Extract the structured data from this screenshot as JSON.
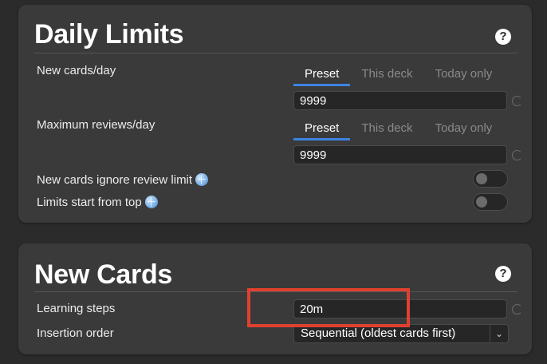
{
  "daily_limits": {
    "title": "Daily Limits",
    "help_symbol": "?",
    "tab_labels": {
      "preset": "Preset",
      "this_deck": "This deck",
      "today_only": "Today only"
    },
    "new_cards_label": "New cards/day",
    "new_cards_value": "9999",
    "max_reviews_label": "Maximum reviews/day",
    "max_reviews_value": "9999",
    "ignore_review_limit_label": "New cards ignore review limit",
    "limits_from_top_label": "Limits start from top",
    "active_tab_color": "#3d83e0"
  },
  "new_cards": {
    "title": "New Cards",
    "help_symbol": "?",
    "learning_steps_label": "Learning steps",
    "learning_steps_value": "20m",
    "insertion_order_label": "Insertion order",
    "insertion_order_value": "Sequential (oldest cards first)"
  },
  "highlight_color": "#e0412f"
}
